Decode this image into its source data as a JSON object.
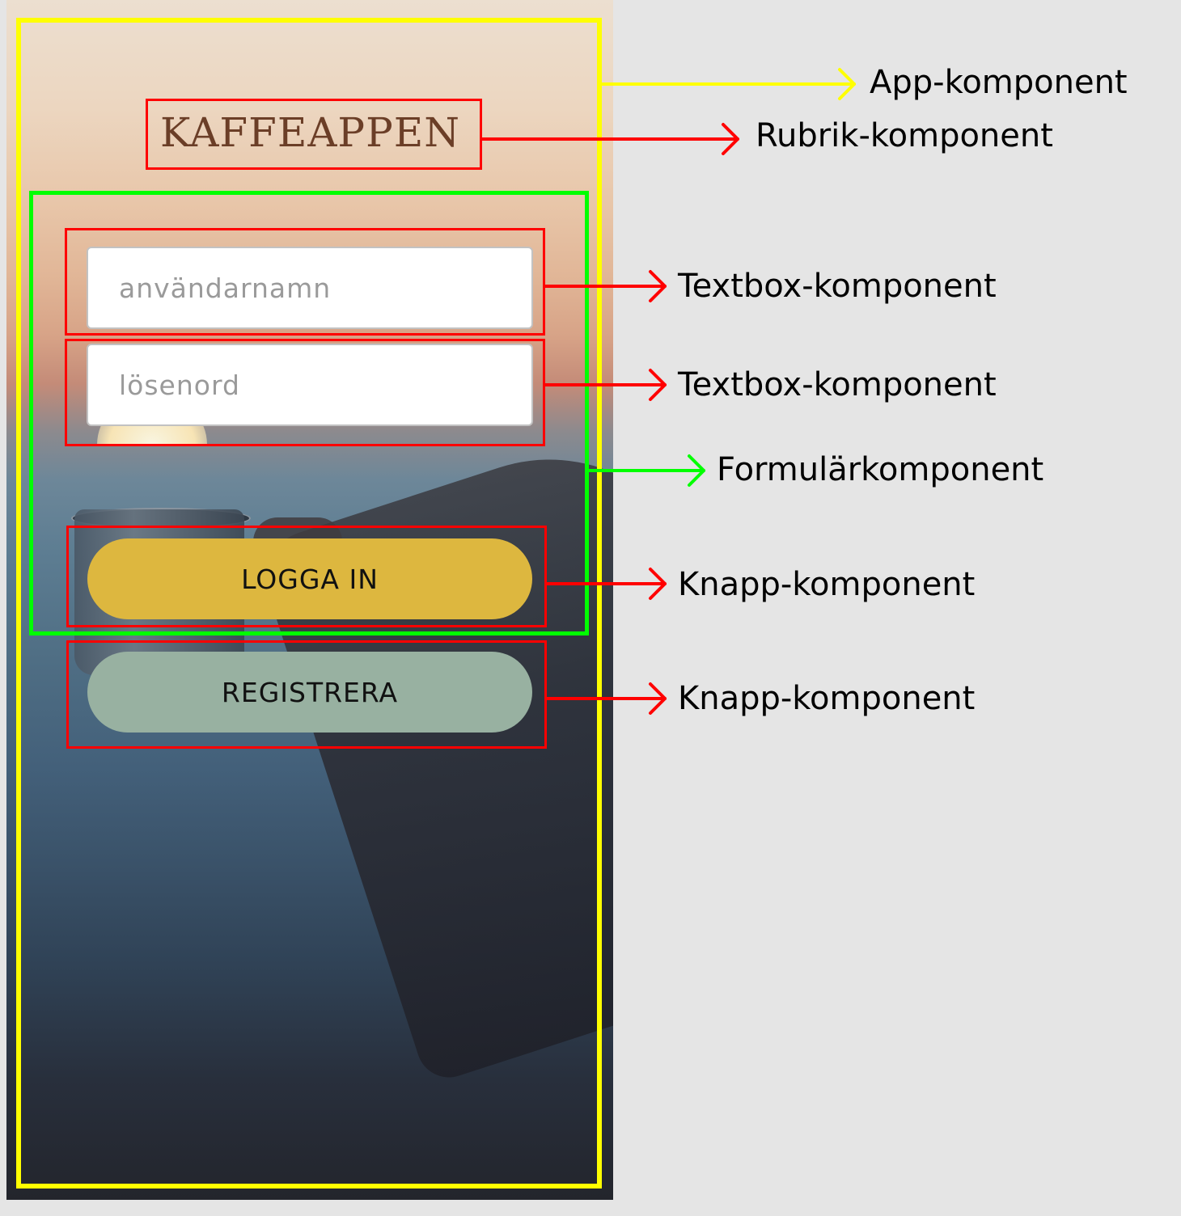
{
  "app": {
    "title": "KAFFEAPPEN",
    "username_placeholder": "användarnamn",
    "password_placeholder": "lösenord",
    "login_button": "LOGGA IN",
    "register_button": "REGISTRERA"
  },
  "annotations": {
    "app_component": "App-komponent",
    "title_component": "Rubrik-komponent",
    "textbox_component_1": "Textbox-komponent",
    "textbox_component_2": "Textbox-komponent",
    "form_component": "Formulärkomponent",
    "button_component_1": "Knapp-komponent",
    "button_component_2": "Knapp-komponent"
  },
  "colors": {
    "app_outline": "#ffff00",
    "form_outline": "#00ff00",
    "component_outline": "#ff0000",
    "login_button": "#ddb73f",
    "register_button": "#98b1a1",
    "title_text": "#6b3e27",
    "background": "#e5e5e5"
  }
}
